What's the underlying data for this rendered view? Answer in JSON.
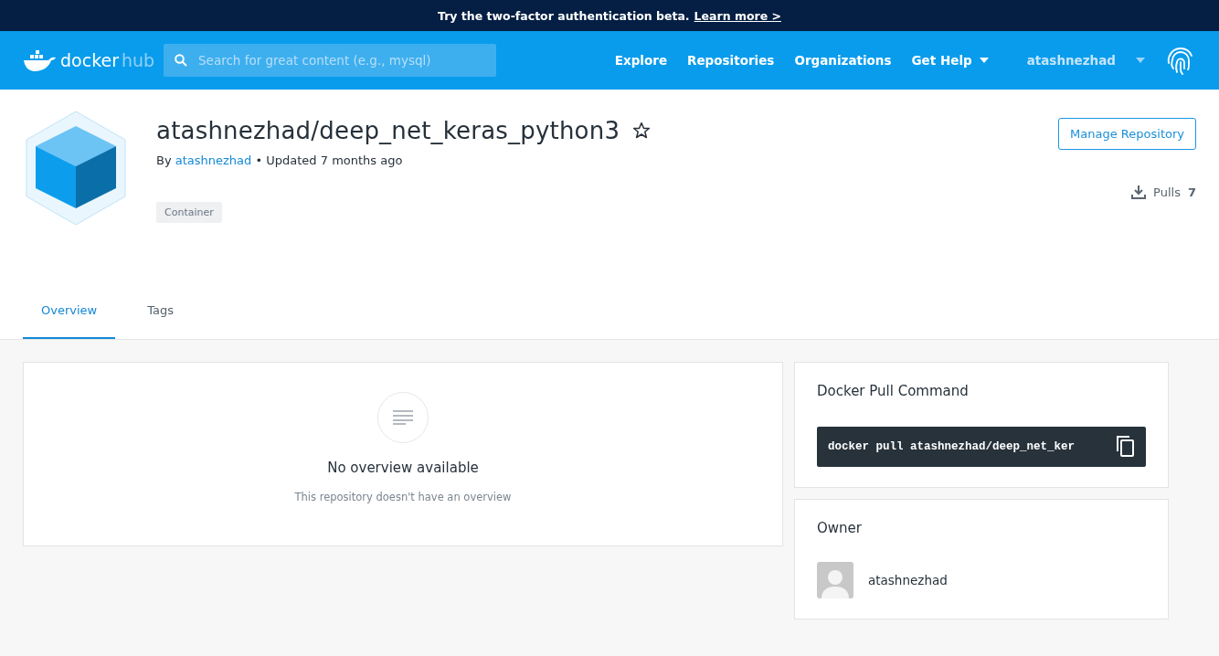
{
  "banner": {
    "text": "Try the two-factor authentication beta.",
    "link": "Learn more >"
  },
  "header": {
    "logo": {
      "word_1": "docker",
      "word_2": "hub"
    },
    "search": {
      "placeholder": "Search for great content (e.g., mysql)"
    },
    "nav": [
      {
        "label": "Explore",
        "dropdown": false
      },
      {
        "label": "Repositories",
        "dropdown": false
      },
      {
        "label": "Organizations",
        "dropdown": false
      },
      {
        "label": "Get Help",
        "dropdown": true
      }
    ],
    "user": "atashnezhad"
  },
  "repo": {
    "title": "atashnezhad/deep_net_keras_python3",
    "starred": false,
    "by_label": "By",
    "owner_link": "atashnezhad",
    "updated": "• Updated 7 months ago",
    "tag": "Container",
    "manage_button": "Manage Repository",
    "pulls_label": "Pulls",
    "pulls_count": "7"
  },
  "tabs": [
    {
      "label": "Overview",
      "selected": true
    },
    {
      "label": "Tags",
      "selected": false
    }
  ],
  "overview": {
    "title": "No overview available",
    "subtitle": "This repository doesn't have an overview"
  },
  "pull_command": {
    "title": "Docker Pull Command",
    "command": "docker pull atashnezhad/deep_net_ker"
  },
  "owner": {
    "title": "Owner",
    "name": "atashnezhad"
  }
}
